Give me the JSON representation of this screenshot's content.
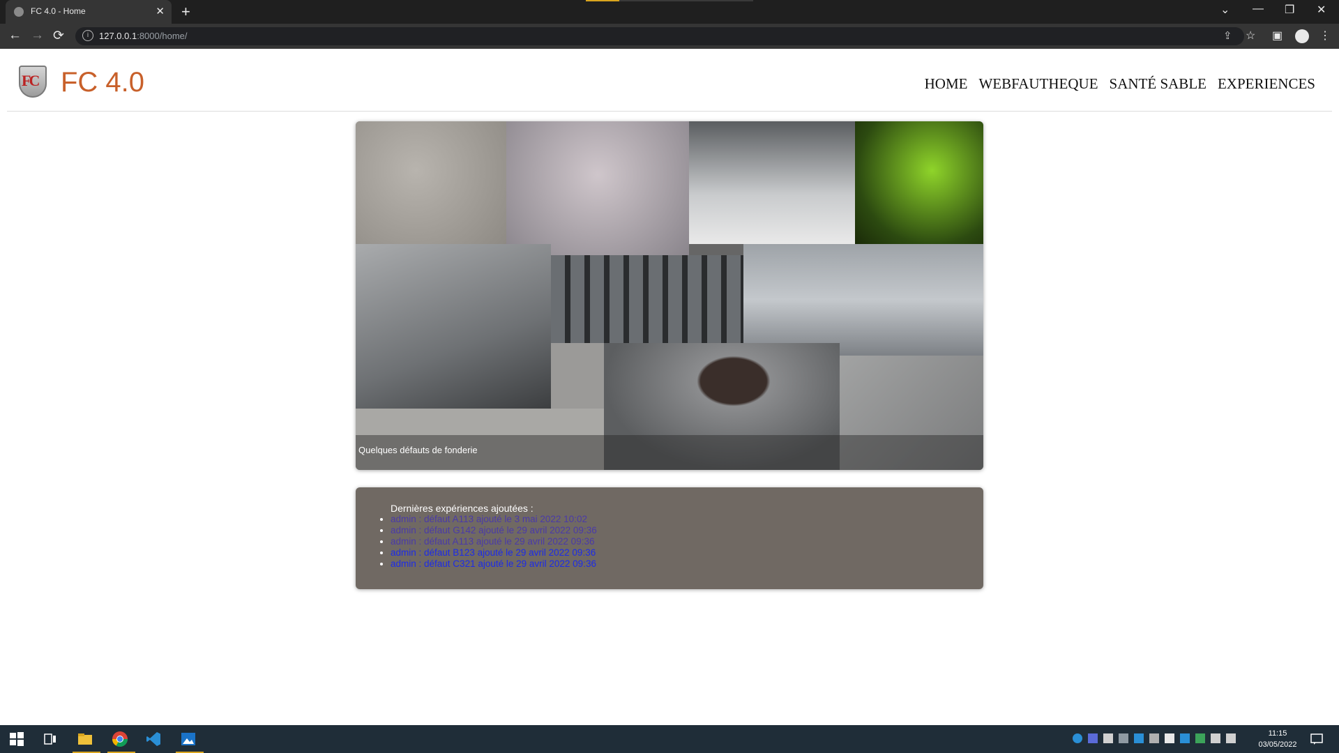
{
  "browser": {
    "tab_title": "FC 4.0 - Home",
    "tab_close": "✕",
    "new_tab": "+",
    "url_host": "127.0.0.1",
    "url_path": ":8000/home/",
    "back": "←",
    "forward": "→",
    "reload": "⟳",
    "info": "i",
    "share": "⇪",
    "star": "☆",
    "sidebar": "▣",
    "menu": "⋮",
    "win_list": "⌄",
    "win_min": "—",
    "win_restore": "❐",
    "win_close": "✕"
  },
  "header": {
    "logo_text": "FC",
    "brand": "FC 4.0",
    "nav": [
      "HOME",
      "WEBFAUTHEQUE",
      "SANTÉ SABLE",
      "EXPERIENCES"
    ]
  },
  "carousel": {
    "caption": "Quelques défauts de fonderie"
  },
  "latest": {
    "heading": "Dernières expériences ajoutées :",
    "items": [
      "admin : défaut A113 ajouté le 3 mai 2022 10:02",
      "admin : défaut G142 ajouté le 29 avril 2022 09:36",
      "admin : défaut A113 ajouté le 29 avril 2022 09:36",
      "admin : défaut B123 ajouté le 29 avril 2022 09:36",
      "admin : défaut C321 ajouté le 29 avril 2022 09:36"
    ]
  },
  "taskbar": {
    "time": "11:15",
    "date": "03/05/2022"
  },
  "colors": {
    "brand": "#c8602a",
    "visited_link": "#4a3aa8",
    "link": "#1c2be8",
    "panel": "#706963"
  }
}
